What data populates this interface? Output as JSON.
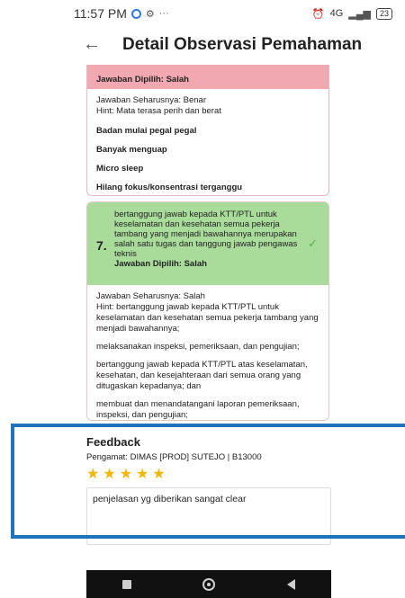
{
  "statusbar": {
    "time": "11:57 PM",
    "network": "4G",
    "battery": "23"
  },
  "header": {
    "title": "Detail Observasi Pemahaman",
    "back_icon": "arrow-left-icon"
  },
  "q6": {
    "selected": "Jawaban Dipilih: Salah",
    "correct": "Jawaban Seharusnya: Benar",
    "hint": "Hint: Mata terasa perih dan berat",
    "options": [
      "Badan mulai pegal pegal",
      "Banyak menguap",
      "Micro sleep",
      "Hilang fokus/konsentrasi terganggu"
    ]
  },
  "q7": {
    "number": "7.",
    "question": "bertanggung jawab kepada KTT/PTL untuk keselamatan dan kesehatan semua pekerja tambang yang menjadi bawahannya merupakan salah satu tugas dan tanggung jawab pengawas teknis",
    "selected": "Jawaban Dipilih: Salah",
    "correct": "Jawaban Seharusnya: Salah",
    "hint": "Hint: bertanggung jawab kepada KTT/PTL untuk keselamatan dan kesehatan semua pekerja tambang yang menjadi bawahannya;",
    "options": [
      "melaksanakan inspeksi, pemeriksaan, dan pengujian;",
      "bertanggung jawab kepada KTT/PTL atas keselamatan, kesehatan, dan kesejahteraan dari semua orang yang ditugaskan kepadanya; dan",
      "membuat dan menandatangani laporan pemeriksaan, inspeksi, dan pengujian;"
    ]
  },
  "feedback": {
    "title": "Feedback",
    "observer": "Pengamat: DIMAS [PROD] SUTEJO | B13000",
    "rating": 5,
    "comment": "penjelasan yg diberikan sangat clear"
  }
}
